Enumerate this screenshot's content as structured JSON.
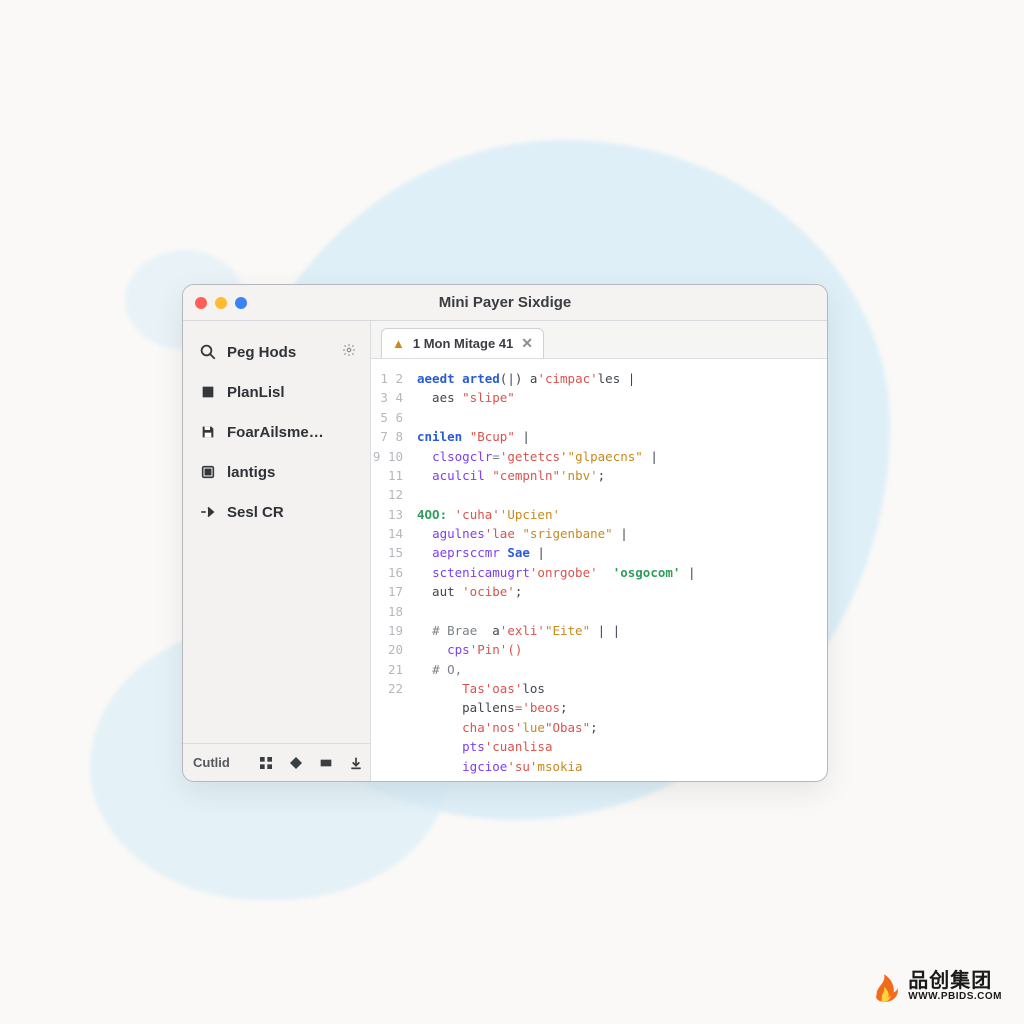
{
  "window": {
    "title": "Mini Payer Sixdige"
  },
  "sidebar": {
    "items": [
      {
        "icon": "search-icon",
        "label": "Peg Hods",
        "gear": true
      },
      {
        "icon": "square-icon",
        "label": "PlanLisl",
        "gear": false
      },
      {
        "icon": "save-icon",
        "label": "FoarAilsme…",
        "gear": false
      },
      {
        "icon": "box-icon",
        "label": "lantigs",
        "gear": false
      },
      {
        "icon": "arrow-icon",
        "label": "Sesl CR",
        "gear": false
      }
    ],
    "footer": {
      "label": "Cutlid"
    }
  },
  "tab": {
    "warn": "▲",
    "label": "1 Mon Mitage 41",
    "close": "✕"
  },
  "code": {
    "line_numbers": [
      "1",
      "2",
      "3",
      "4",
      "5",
      "6",
      "7",
      "8",
      "9",
      "10",
      "11",
      "12",
      "13",
      "14",
      "15",
      "16",
      "17",
      "18",
      "19",
      "20",
      "21",
      "22"
    ],
    "tokens": [
      [
        [
          "kw",
          "aeedt arted"
        ],
        [
          "",
          "(|) a"
        ],
        [
          "str",
          "'cimpac'"
        ],
        [
          "",
          "les |"
        ]
      ],
      [
        [
          "",
          "  aes "
        ],
        [
          "str",
          "\"slipe\""
        ]
      ],
      [
        [
          "",
          " "
        ]
      ],
      [
        [
          "kw",
          "cnilen "
        ],
        [
          "str",
          "\"Bcup\""
        ],
        [
          "",
          " |"
        ]
      ],
      [
        [
          "",
          "  "
        ],
        [
          "fn",
          "clsogclr"
        ],
        [
          "cm",
          "="
        ],
        [
          "str",
          "'getetcs'"
        ],
        [
          "lit",
          "\"glpaecns\""
        ],
        [
          "",
          " |"
        ]
      ],
      [
        [
          "",
          "  "
        ],
        [
          "fn",
          "aculcil "
        ],
        [
          "str",
          "\"cempnln\""
        ],
        [
          "lit",
          "'nbv'"
        ],
        [
          "",
          ";"
        ]
      ],
      [
        [
          "",
          " "
        ]
      ],
      [
        [
          "ok",
          "4OO:"
        ],
        [
          "",
          " "
        ],
        [
          "str",
          "'cuha'"
        ],
        [
          "lit",
          "'Upcien'"
        ]
      ],
      [
        [
          "",
          "  "
        ],
        [
          "fn",
          "agulnes"
        ],
        [
          "str",
          "'lae "
        ],
        [
          "lit",
          "\"srigenbane\""
        ],
        [
          "",
          " |"
        ]
      ],
      [
        [
          "",
          "  "
        ],
        [
          "fn",
          "aeprsccmr"
        ],
        [
          "kw",
          " Sae"
        ],
        [
          "",
          " |"
        ]
      ],
      [
        [
          "",
          "  "
        ],
        [
          "fn",
          "sctenicamugrt"
        ],
        [
          "str",
          "'onrgobe'"
        ],
        [
          "",
          "  "
        ],
        [
          "ok",
          "'osgocom'"
        ],
        [
          "",
          " |"
        ]
      ],
      [
        [
          "",
          "  aut "
        ],
        [
          "str",
          "'ocibe'"
        ],
        [
          "",
          ";"
        ]
      ],
      [
        [
          "",
          " "
        ]
      ],
      [
        [
          "",
          "  "
        ],
        [
          "cm",
          "# Brae"
        ],
        [
          "",
          "  a"
        ],
        [
          "str",
          "'exli'"
        ],
        [
          "lit",
          "\"Eite\""
        ],
        [
          "",
          " | |"
        ]
      ],
      [
        [
          "",
          "    "
        ],
        [
          "fn",
          "cps"
        ],
        [
          "str",
          "'Pin'()"
        ]
      ],
      [
        [
          "",
          "  "
        ],
        [
          "cm",
          "# O,"
        ]
      ],
      [
        [
          "",
          "      "
        ],
        [
          "str",
          "Tas'oas'"
        ],
        [
          "",
          "los"
        ]
      ],
      [
        [
          "",
          "      "
        ],
        [
          "",
          "pallens"
        ],
        [
          "str",
          "='beos"
        ],
        [
          "",
          ";"
        ]
      ],
      [
        [
          "",
          "      "
        ],
        [
          "str",
          "cha'nos'"
        ],
        [
          "lit",
          "lue"
        ],
        [
          "str",
          "\"Obas\""
        ],
        [
          "",
          ";"
        ]
      ],
      [
        [
          "",
          "      "
        ],
        [
          "fn",
          "pts"
        ],
        [
          "str",
          "'cuanlisa"
        ]
      ],
      [
        [
          "",
          "      "
        ],
        [
          "fn",
          "igcioe"
        ],
        [
          "str",
          "'su'"
        ],
        [
          "lit",
          "msokia"
        ]
      ],
      [
        [
          "ok",
          "○ ○"
        ]
      ]
    ]
  },
  "watermark": {
    "cn": "品创集团",
    "url": "WWW.PBIDS.COM"
  }
}
